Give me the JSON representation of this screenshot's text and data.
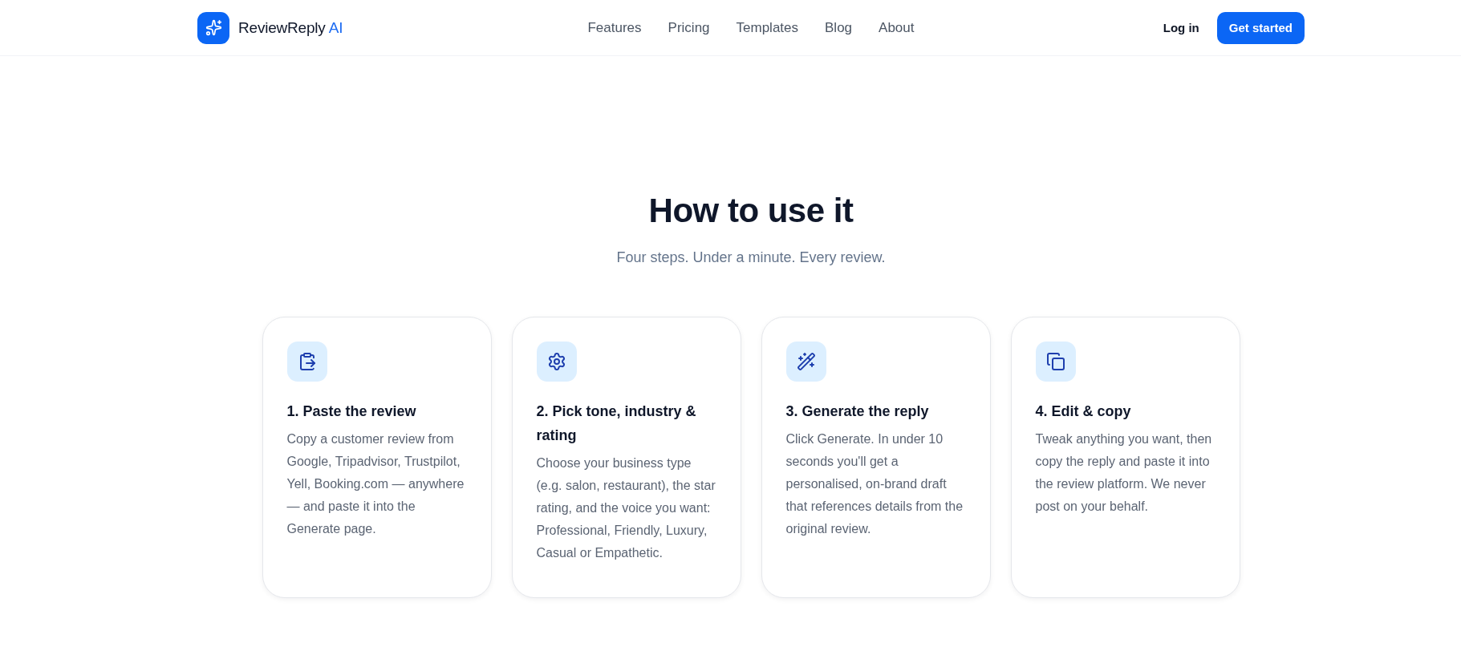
{
  "header": {
    "brand": {
      "name": "ReviewReply",
      "accent": "AI"
    },
    "nav": [
      "Features",
      "Pricing",
      "Templates",
      "Blog",
      "About"
    ],
    "login": "Log in",
    "cta": "Get started"
  },
  "section": {
    "title": "How to use it",
    "subtitle": "Four steps. Under a minute. Every review.",
    "steps": [
      {
        "title": "1. Paste the review",
        "description": "Copy a customer review from Google, Tripadvisor, Trustpilot, Yell, Booking.com — anywhere — and paste it into the Generate page."
      },
      {
        "title": "2. Pick tone, industry & rating",
        "description": "Choose your business type (e.g. salon, restaurant), the star rating, and the voice you want: Professional, Friendly, Luxury, Casual or Empathetic."
      },
      {
        "title": "3. Generate the reply",
        "description": "Click Generate. In under 10 seconds you'll get a personalised, on-brand draft that references details from the original review."
      },
      {
        "title": "4. Edit & copy",
        "description": "Tweak anything you want, then copy the reply and paste it into the review platform. We never post on your behalf."
      }
    ]
  }
}
